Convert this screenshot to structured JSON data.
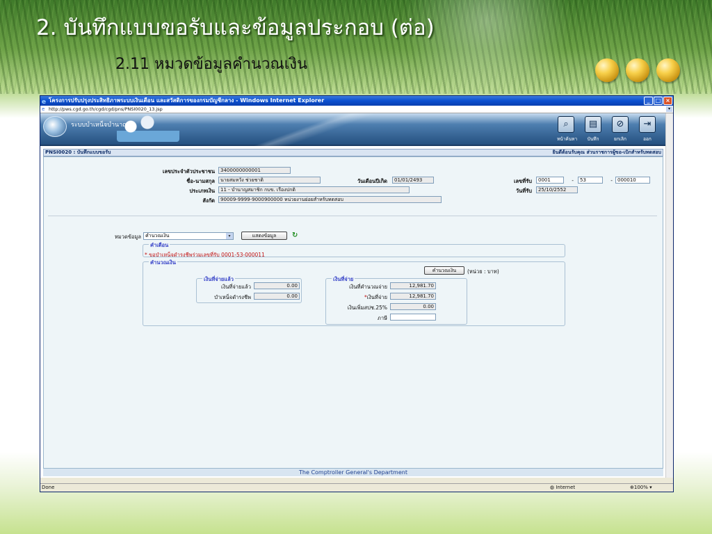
{
  "slide": {
    "title": "2. บันทึกแบบขอรับและข้อมูลประกอบ (ต่อ)",
    "subtitle": "2.11 หมวดข้อมูลคำนวณเงิน"
  },
  "browser": {
    "title": "โครงการปรับปรุงประสิทธิภาพระบบเงินเดือน และสวัสดิการของกรมบัญชีกลาง - Windows Internet Explorer",
    "address": "http://pws.cgd.go.th/cgd/cgd/pns/PNSI0020_13.jsp",
    "status": "Done",
    "zone": "Internet",
    "zoom": "100%"
  },
  "app": {
    "name": "ระบบบำเหน็จบำนาญ",
    "toolbar": {
      "search": "หน้าค้นหา",
      "save": "บันทึก",
      "cancel": "ยกเลิก",
      "exit": "ออก"
    },
    "page_code": "PNSI0020 : บันทึกแบบขอรับ",
    "welcome": "ยินดีต้อนรับคุณ ส่วนราชการผู้ขอ-เบิกสำหรับทดสอบ",
    "footer": "The Comptroller General's Department"
  },
  "form": {
    "id_label": "เลขประจำตัวประชาชน",
    "id_value": "3400000000001",
    "name_label": "ชื่อ-นามสกุล",
    "name_value": "นายสมหวัง ช่วยชาติ",
    "birth_label": "วันเดือนปีเกิด",
    "birth_value": "01/01/2493",
    "type_label": "ประเภทเงิน",
    "type_value": "11 - บำนาญสมาชิก กบข. เรื่องปกติ",
    "org_label": "สังกัด",
    "org_value": "90009-9999-9000900000  หน่วยงานย่อยสำหรับทดสอบ",
    "receipt_no_label": "เลขที่รับ",
    "receipt_no_1": "0001",
    "receipt_no_2": "53",
    "receipt_no_3": "000010",
    "receipt_sep": "-",
    "receipt_date_label": "วันที่รับ",
    "receipt_date_value": "25/10/2552",
    "category_label": "หมวดข้อมูล",
    "category_value": "คำนวณเงิน",
    "show_button": "แสดงข้อมูล",
    "warning_legend": "คำเตือน",
    "warning_text": "ขอบำเหน็จดำรงชีพร่วมเลขที่รับ 0001-53-000011",
    "calc_legend": "คำนวณเงิน",
    "calc_button": "คำนวณเงิน",
    "unit_text": "(หน่วย : บาท)",
    "paid": {
      "legend": "เงินที่จ่ายแล้ว",
      "paid_label": "เงินที่จ่ายแล้ว",
      "paid_value": "0.00",
      "living_label": "บำเหน็จดำรงชีพ",
      "living_value": "0.00"
    },
    "pay": {
      "legend": "เงินที่จ่าย",
      "calc_label": "เงินที่คำนวณจ่าย",
      "calc_value": "12,981.70",
      "pay_label": "เงินที่จ่าย",
      "pay_value": "12,981.70",
      "extra_label": "เงินเพิ่มสปช.25%",
      "extra_value": "0.00",
      "tax_label": "ภาษี",
      "tax_value": ""
    }
  }
}
